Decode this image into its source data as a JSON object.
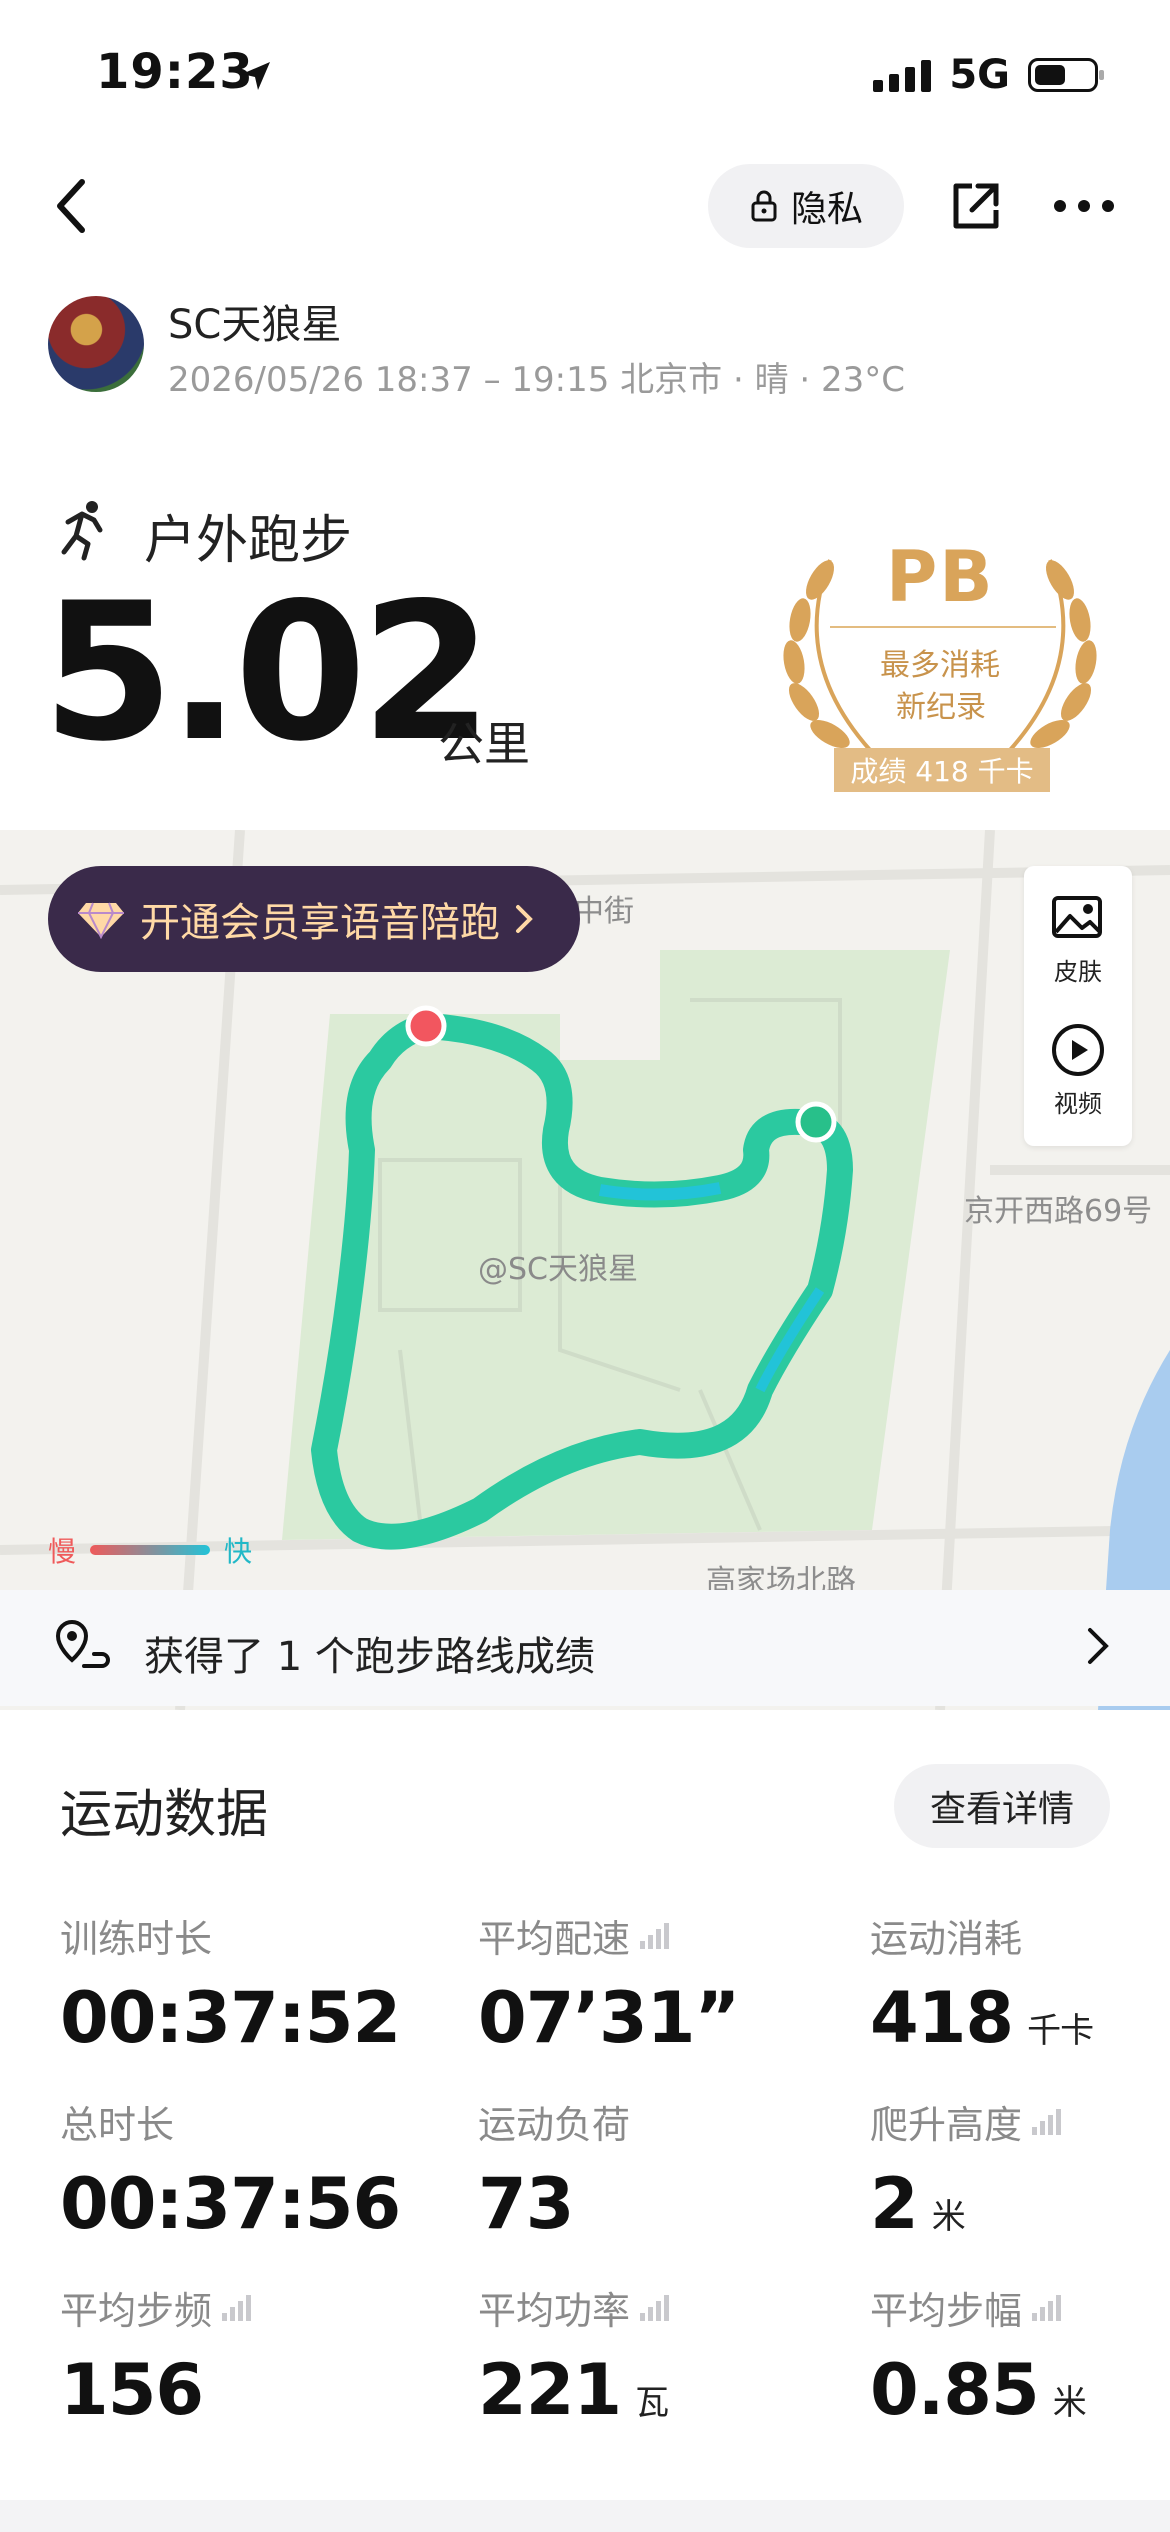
{
  "status_bar": {
    "time": "19:23",
    "network": "5G"
  },
  "header": {
    "privacy_label": "隐私"
  },
  "user": {
    "name": "SC天狼星",
    "meta": "2026/05/26 18:37 – 19:15 北京市 · 晴 · 23°C"
  },
  "workout": {
    "type": "户外跑步",
    "distance": "5.02",
    "distance_unit": "公里"
  },
  "pb_badge": {
    "title": "PB",
    "line1": "最多消耗",
    "line2": "新纪录",
    "score": "成绩 418 千卡"
  },
  "map": {
    "vip_banner": "开通会员享语音陪跑",
    "tools": [
      {
        "label": "皮肤",
        "icon": "image-icon"
      },
      {
        "label": "视频",
        "icon": "play-icon"
      }
    ],
    "labels": {
      "street_top": "中街",
      "road_right": "京开西路69号",
      "road_bottom": "高家场北路"
    },
    "watermark": "@SC天狼星",
    "legend": {
      "slow": "慢",
      "fast": "快"
    },
    "route_colors": {
      "start": "#28c08a",
      "end": "#f2565f",
      "route": "#2bc9a0",
      "fast": "#22c3d8"
    }
  },
  "achievement": {
    "text": "获得了 1 个跑步路线成绩"
  },
  "stats": {
    "title": "运动数据",
    "detail_button": "查看详情",
    "items": [
      {
        "label": "训练时长",
        "value": "00:37:52",
        "unit": "",
        "chart": false
      },
      {
        "label": "平均配速",
        "value": "07’31”",
        "unit": "",
        "chart": true
      },
      {
        "label": "运动消耗",
        "value": "418",
        "unit": "千卡",
        "chart": false
      },
      {
        "label": "总时长",
        "value": "00:37:56",
        "unit": "",
        "chart": false
      },
      {
        "label": "运动负荷",
        "value": "73",
        "unit": "",
        "chart": false
      },
      {
        "label": "爬升高度",
        "value": "2",
        "unit": "米",
        "chart": true
      },
      {
        "label": "平均步频",
        "value": "156",
        "unit": "",
        "chart": true
      },
      {
        "label": "平均功率",
        "value": "221",
        "unit": "瓦",
        "chart": true
      },
      {
        "label": "平均步幅",
        "value": "0.85",
        "unit": "米",
        "chart": true
      }
    ]
  }
}
